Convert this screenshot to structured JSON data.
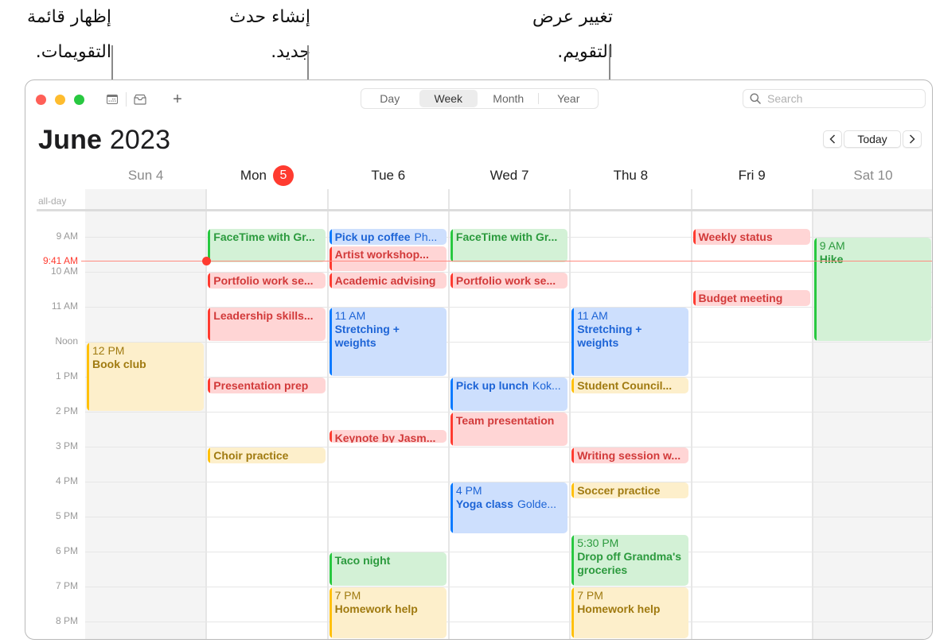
{
  "callouts": {
    "calendars": "إظهار قائمة التقويمات.",
    "new_event": "إنشاء حدث جديد.",
    "view": "تغيير عرض التقويم."
  },
  "toolbar": {
    "traffic_lights": {
      "close": "#ff5f57",
      "minimize": "#febc2e",
      "zoom": "#28c840"
    },
    "calendar_list_icon": "calendar-list-icon",
    "inbox_icon": "inbox-icon",
    "add_label": "+",
    "views": [
      "Day",
      "Week",
      "Month",
      "Year"
    ],
    "active_view": "Week",
    "search_placeholder": "Search",
    "search_value": ""
  },
  "header": {
    "month": "June",
    "year": "2023",
    "prev_label": "‹",
    "today_label": "Today",
    "next_label": "›"
  },
  "days": [
    {
      "name": "Sun",
      "date": "4",
      "weekend": true
    },
    {
      "name": "Mon",
      "date": "5",
      "today": true
    },
    {
      "name": "Tue",
      "date": "6"
    },
    {
      "name": "Wed",
      "date": "7"
    },
    {
      "name": "Thu",
      "date": "8"
    },
    {
      "name": "Fri",
      "date": "9"
    },
    {
      "name": "Sat",
      "date": "10",
      "weekend": true
    }
  ],
  "allday_label": "all-day",
  "hours": [
    "9 AM",
    "10 AM",
    "11 AM",
    "Noon",
    "1 PM",
    "2 PM",
    "3 PM",
    "4 PM",
    "5 PM",
    "6 PM",
    "7 PM",
    "8 PM"
  ],
  "now": {
    "label": "9:41 AM",
    "time": 9.683
  },
  "colors": {
    "red": "#ff3b30",
    "green": "#28c840",
    "blue": "#0a7aff",
    "yellow": "#ffc00a"
  },
  "events": [
    {
      "day": 0,
      "start": 12,
      "end": 14,
      "color": "yellow",
      "time": "12 PM",
      "title": "Book club"
    },
    {
      "day": 1,
      "start": 8.75,
      "end": 9.75,
      "color": "green",
      "title": "FaceTime with Gr..."
    },
    {
      "day": 1,
      "start": 10,
      "end": 10.5,
      "color": "red",
      "title": "Portfolio work se..."
    },
    {
      "day": 1,
      "start": 11,
      "end": 12,
      "color": "red",
      "title": "Leadership skills..."
    },
    {
      "day": 1,
      "start": 13,
      "end": 13.5,
      "color": "red",
      "title": "Presentation prep"
    },
    {
      "day": 1,
      "start": 15,
      "end": 15.5,
      "color": "yellow",
      "title": "Choir practice"
    },
    {
      "day": 2,
      "start": 8.75,
      "end": 9.25,
      "color": "blue",
      "title": "Pick up coffee",
      "location": "Ph..."
    },
    {
      "day": 2,
      "start": 9.25,
      "end": 10,
      "color": "red",
      "title": "Artist workshop..."
    },
    {
      "day": 2,
      "start": 10,
      "end": 10.5,
      "color": "red",
      "title": "Academic advising"
    },
    {
      "day": 2,
      "start": 11,
      "end": 13,
      "color": "blue",
      "time": "11 AM",
      "title": "Stretching + weights",
      "wrap": true
    },
    {
      "day": 2,
      "start": 14.5,
      "end": 14.9,
      "color": "red",
      "title": "Keynote by Jasm..."
    },
    {
      "day": 2,
      "start": 18,
      "end": 19,
      "color": "green",
      "title": "Taco night"
    },
    {
      "day": 2,
      "start": 19,
      "end": 20.5,
      "color": "yellow",
      "time": "7 PM",
      "title": "Homework help"
    },
    {
      "day": 3,
      "start": 8.75,
      "end": 9.75,
      "color": "green",
      "title": "FaceTime with Gr..."
    },
    {
      "day": 3,
      "start": 10,
      "end": 10.5,
      "color": "red",
      "title": "Portfolio work se..."
    },
    {
      "day": 3,
      "start": 13,
      "end": 14,
      "color": "blue",
      "title": "Pick up lunch",
      "location": "Kok..."
    },
    {
      "day": 3,
      "start": 14,
      "end": 15,
      "color": "red",
      "title": "Team presentation"
    },
    {
      "day": 3,
      "start": 16,
      "end": 17.5,
      "color": "blue",
      "time": "4 PM",
      "title": "Yoga class",
      "location": "Golde..."
    },
    {
      "day": 4,
      "start": 11,
      "end": 13,
      "color": "blue",
      "time": "11 AM",
      "title": "Stretching + weights",
      "wrap": true
    },
    {
      "day": 4,
      "start": 13,
      "end": 13.5,
      "color": "yellow",
      "title": "Student Council..."
    },
    {
      "day": 4,
      "start": 15,
      "end": 15.5,
      "color": "red",
      "title": "Writing session w..."
    },
    {
      "day": 4,
      "start": 16,
      "end": 16.5,
      "color": "yellow",
      "title": "Soccer practice"
    },
    {
      "day": 4,
      "start": 17.5,
      "end": 19,
      "color": "green",
      "time": "5:30 PM",
      "title": "Drop off Grandma's groceries",
      "wrap": true
    },
    {
      "day": 4,
      "start": 19,
      "end": 20.5,
      "color": "yellow",
      "time": "7 PM",
      "title": "Homework help"
    },
    {
      "day": 5,
      "start": 8.75,
      "end": 9.25,
      "color": "red",
      "title": "Weekly status"
    },
    {
      "day": 5,
      "start": 10.5,
      "end": 11,
      "color": "red",
      "title": "Budget meeting"
    },
    {
      "day": 6,
      "start": 9,
      "end": 12,
      "color": "green",
      "time": "9 AM",
      "title": "Hike"
    }
  ]
}
